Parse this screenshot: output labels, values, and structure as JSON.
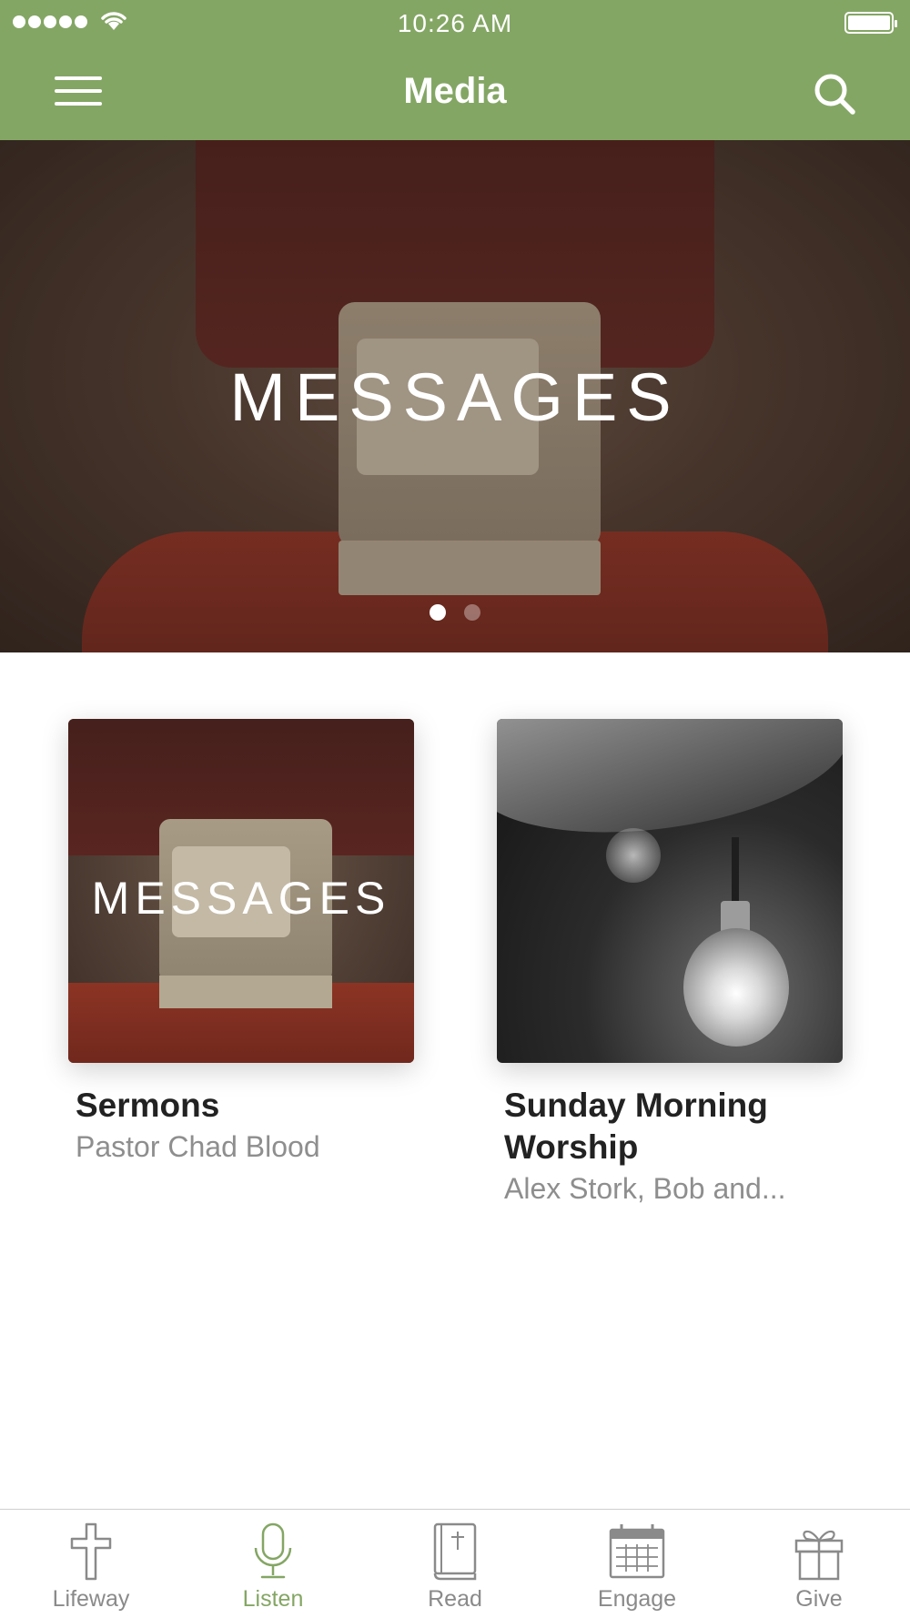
{
  "status_bar": {
    "time": "10:26 AM",
    "signal_dots": 5
  },
  "header": {
    "title": "Media",
    "menu_icon": "hamburger-icon",
    "search_icon": "search-icon",
    "accent_color": "#84a664"
  },
  "hero": {
    "title": "MESSAGES",
    "page_count": 2,
    "active_page": 1
  },
  "cards": [
    {
      "title": "Sermons",
      "subtitle": "Pastor Chad Blood",
      "thumb_title": "MESSAGES"
    },
    {
      "title": "Sunday Morning Worship",
      "subtitle": "Alex Stork, Bob and...",
      "thumb_title": ""
    }
  ],
  "tabs": [
    {
      "label": "Lifeway",
      "icon": "cross-icon",
      "active": false
    },
    {
      "label": "Listen",
      "icon": "microphone-icon",
      "active": true
    },
    {
      "label": "Read",
      "icon": "bible-icon",
      "active": false
    },
    {
      "label": "Engage",
      "icon": "calendar-icon",
      "active": false
    },
    {
      "label": "Give",
      "icon": "gift-icon",
      "active": false
    }
  ]
}
